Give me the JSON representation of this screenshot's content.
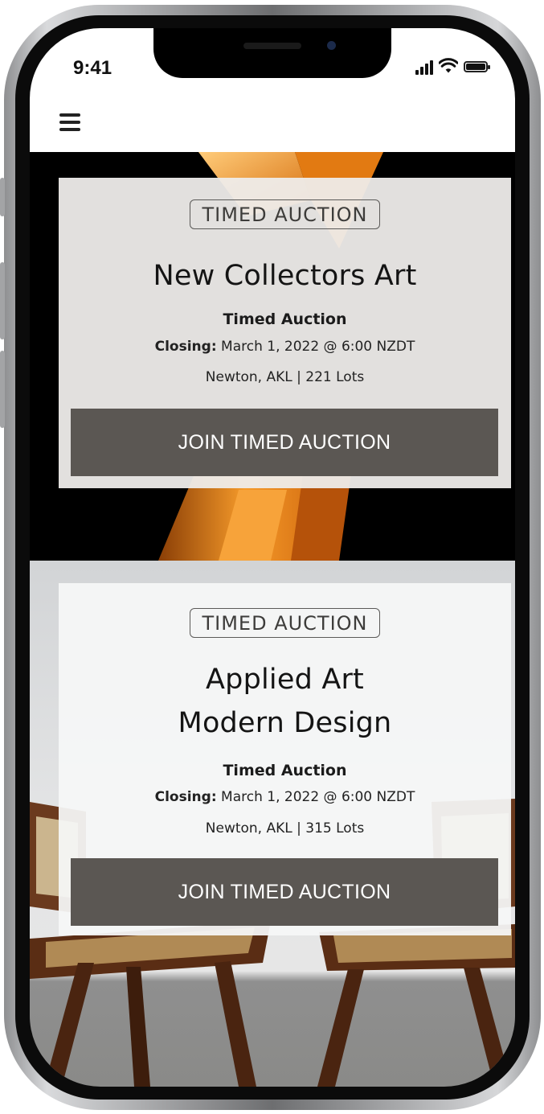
{
  "status_bar": {
    "time": "9:41",
    "icons": [
      "signal-icon",
      "wifi-icon",
      "battery-icon"
    ]
  },
  "nav": {
    "menu_icon": "hamburger-menu-icon"
  },
  "auctions": [
    {
      "badge": "TIMED AUCTION",
      "title": "New Collectors Art",
      "type": "Timed Auction",
      "closing_label": "Closing:",
      "closing_value": "March 1, 2022 @ 6:00 NZDT",
      "location_lots": "Newton, AKL | 221 Lots",
      "button": "JOIN TIMED AUCTION"
    },
    {
      "badge": "TIMED AUCTION",
      "title_line1": "Applied Art",
      "title_line2": "Modern Design",
      "type": "Timed Auction",
      "closing_label": "Closing:",
      "closing_value": "March 1, 2022 @ 6:00 NZDT",
      "location_lots": "Newton, AKL | 315 Lots",
      "button": "JOIN TIMED AUCTION"
    }
  ],
  "colors": {
    "button_bg": "#5b5753",
    "hero1_bg": "#000000",
    "hero1_accent": "#f08a1c"
  }
}
